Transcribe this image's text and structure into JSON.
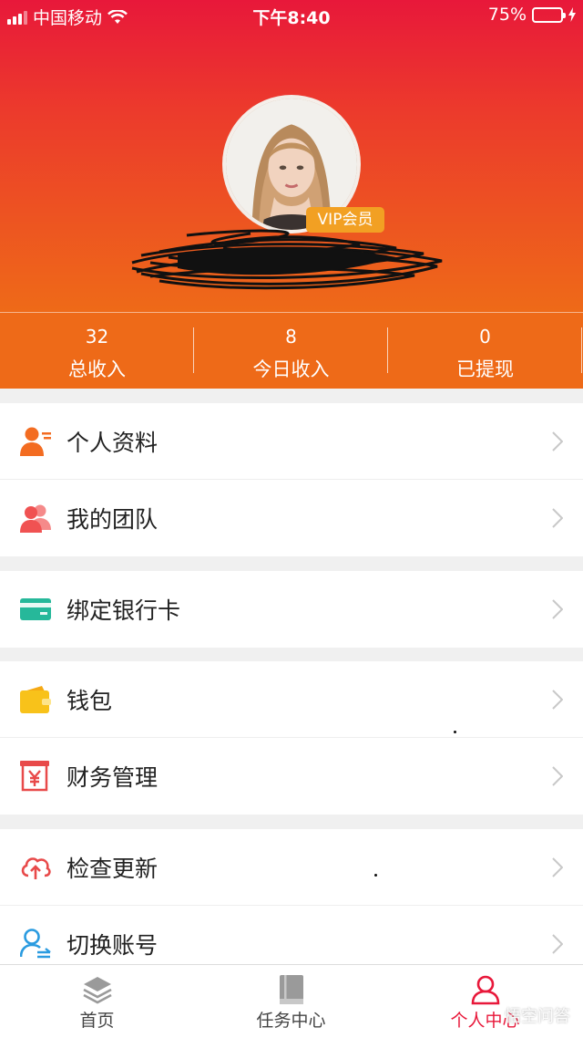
{
  "status_bar": {
    "carrier": "中国移动",
    "time": "下午8:40",
    "battery": "75%",
    "battery_level": 0.75
  },
  "profile": {
    "vip_badge": "VIP会员"
  },
  "stats": [
    {
      "value": "32",
      "label": "总收入"
    },
    {
      "value": "8",
      "label": "今日收入"
    },
    {
      "value": "0",
      "label": "已提现"
    }
  ],
  "menu": {
    "personal_info": {
      "label": "个人资料",
      "icon": "user-card-icon",
      "color": "#f36c21"
    },
    "my_team": {
      "label": "我的团队",
      "icon": "team-icon",
      "color": "#f05252"
    },
    "bind_card": {
      "label": "绑定银行卡",
      "icon": "bank-card-icon",
      "color": "#26b89a"
    },
    "wallet": {
      "label": "钱包",
      "icon": "wallet-icon",
      "color": "#f8c21a"
    },
    "finance": {
      "label": "财务管理",
      "icon": "finance-icon",
      "color": "#e84a4a"
    },
    "check_update": {
      "label": "检查更新",
      "icon": "cloud-upload-icon",
      "color": "#e84a4a"
    },
    "switch_account": {
      "label": "切换账号",
      "icon": "switch-account-icon",
      "color": "#2a9be0"
    }
  },
  "tabbar": [
    {
      "label": "首页",
      "icon": "layers-icon"
    },
    {
      "label": "任务中心",
      "icon": "book-icon"
    },
    {
      "label": "个人中心",
      "icon": "person-icon",
      "active": true
    }
  ],
  "watermark": "悟空问答",
  "colors": {
    "header_top": "#e8183a",
    "header_bottom": "#ee6a18",
    "active_tab": "#e8183a",
    "vip_badge": "#f2a023"
  }
}
